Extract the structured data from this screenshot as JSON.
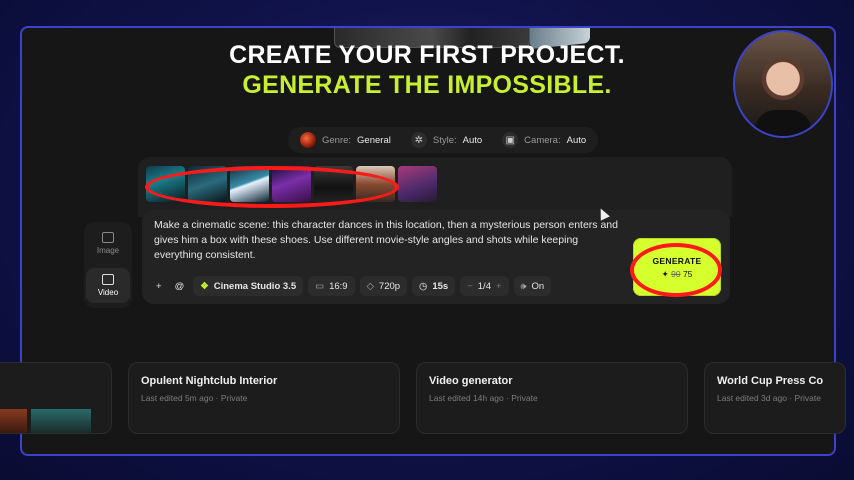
{
  "headline": {
    "line1": "CREATE YOUR FIRST PROJECT.",
    "line2": "GENERATE THE IMPOSSIBLE."
  },
  "settings_chips": [
    {
      "label": "Genre:",
      "value": "General",
      "icon": "genre-orb-icon"
    },
    {
      "label": "Style:",
      "value": "Auto",
      "icon": "style-icon"
    },
    {
      "label": "Camera:",
      "value": "Auto",
      "icon": "camera-icon"
    }
  ],
  "sidebar": {
    "image_label": "Image",
    "video_label": "Video"
  },
  "prompt": {
    "text": "Make a cinematic scene: this character dances in this location, then a mysterious person enters and gives him a box with these shoes. Use different movie-style angles and shots while keeping everything consistent."
  },
  "toolbar": {
    "add": "+",
    "mention": "@",
    "model": "Cinema Studio 3.5",
    "aspect": "16:9",
    "resolution": "720p",
    "duration": "15s",
    "minus": "−",
    "count": "1/4",
    "plus": "+",
    "audio": "On"
  },
  "generate": {
    "label": "GENERATE",
    "old_cost": "90",
    "cost": "75"
  },
  "projects": [
    {
      "title": "Opulent Nightclub Interior",
      "meta": "Last edited 5m ago · Private"
    },
    {
      "title": "Video generator",
      "meta": "Last edited 14h ago · Private"
    },
    {
      "title": "World Cup Press Co",
      "meta": "Last edited 3d ago · Private"
    }
  ],
  "colors": {
    "accent": "#c8f031",
    "generate_bg": "#d6ff2e",
    "annotation": "#ff1a1a",
    "frame_border": "#3b43c9"
  }
}
